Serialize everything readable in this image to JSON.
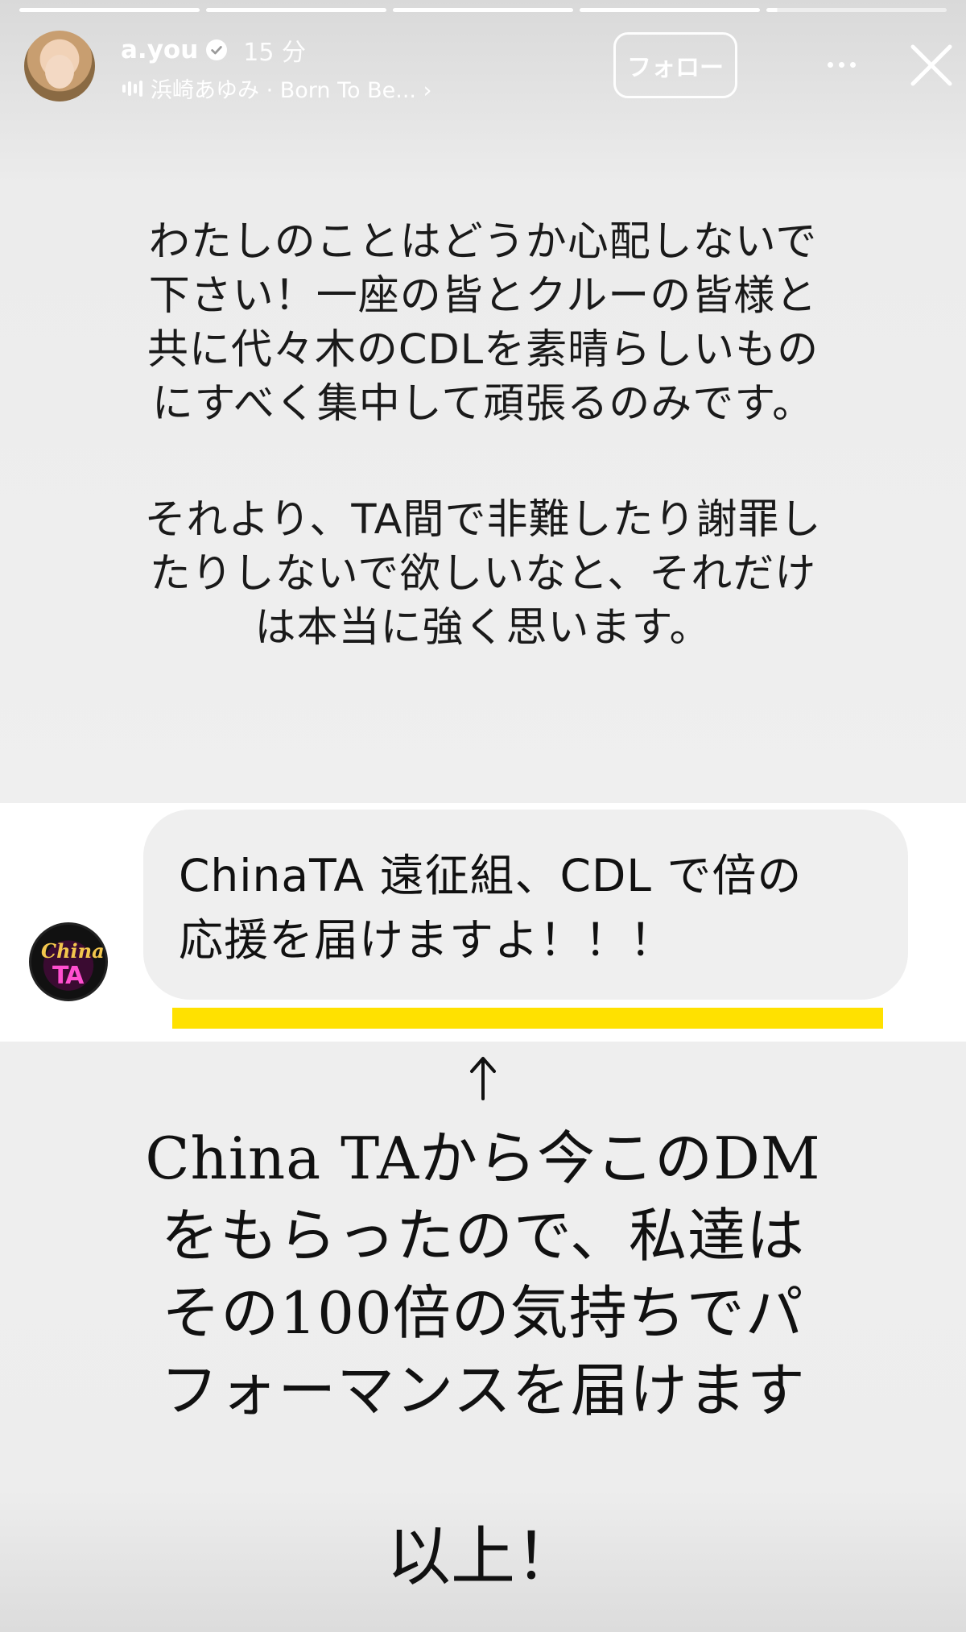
{
  "story": {
    "segments": [
      "done",
      "done",
      "done",
      "done",
      "partial"
    ],
    "user": {
      "username": "a.you",
      "time": "15 分",
      "music": "浜崎あゆみ · Born To Be... ›",
      "follow_label": "フォロー"
    },
    "message": {
      "para1": "わたしのことはどうか心配しないで\n下さい！一座の皆とクルーの皆様と\n共に代々木のCDLを素晴らしいもの\nにすべく集中して頑張るのみです。",
      "para2": "それより、TA間で非難したり謝罪し\nたりしないで欲しいなと、それだけ\nは本当に強く思います。"
    },
    "dm": {
      "avatar_text_top": "China",
      "avatar_text_bottom": "TA",
      "text": "ChinaTA 遠征組、CDL で倍の\n応援を届けますよ！！！"
    },
    "arrow": "↑",
    "caption": "China TAから今このDM\nをもらったので、私達は\nその100倍の気持ちでパ\nフォーマンスを届けます",
    "closing": "以上！",
    "colors": {
      "highlight": "#ffe100",
      "dm_bubble": "#efefef"
    }
  }
}
